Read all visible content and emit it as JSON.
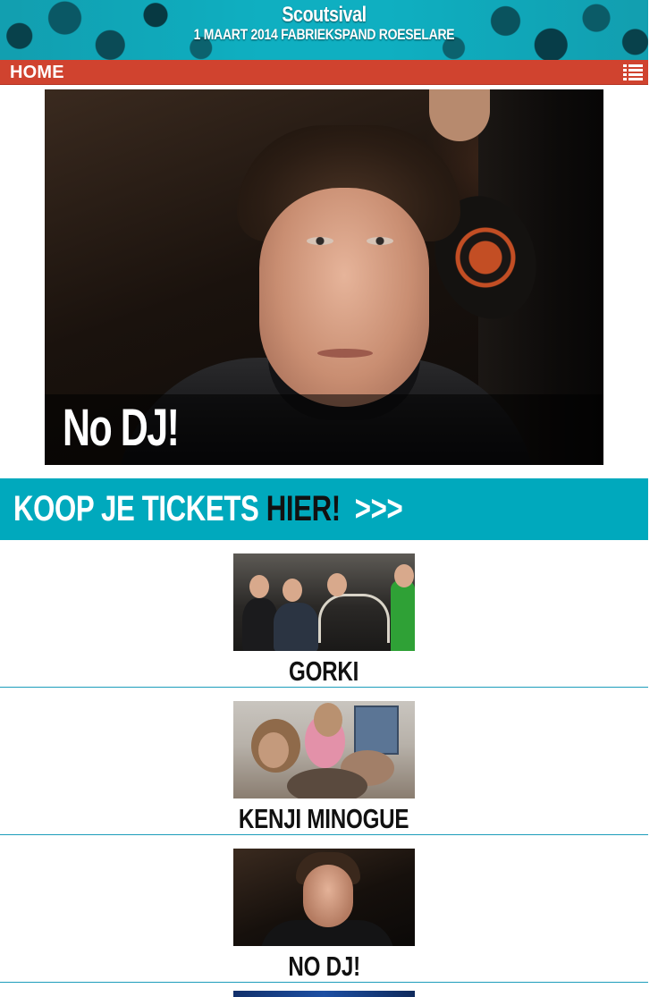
{
  "header": {
    "site_title": "Scoutsival",
    "subtitle": "1 MAART 2014 FABRIEKSPAND ROESELARE"
  },
  "nav": {
    "home_label": "HOME",
    "menu_icon": "list-icon"
  },
  "hero": {
    "caption": "No DJ!"
  },
  "tickets": {
    "text_main": "KOOP JE TICKETS",
    "text_highlight": "HIER!",
    "arrows": ">>>"
  },
  "artists": [
    {
      "name": "GORKI"
    },
    {
      "name": "KENJI MINOGUE"
    },
    {
      "name": "NO DJ!"
    }
  ],
  "colors": {
    "nav_red": "#d0432f",
    "accent_teal": "#00a9bd",
    "divider": "#1d9dbb"
  }
}
